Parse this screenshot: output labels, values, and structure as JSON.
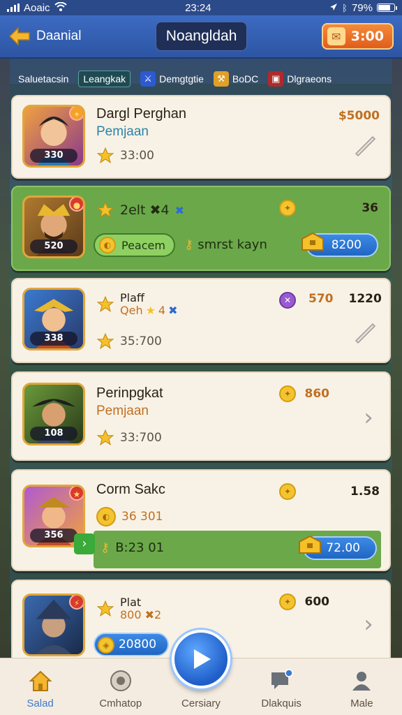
{
  "status_bar": {
    "carrier": "Aoaic",
    "time": "23:24",
    "battery": "79%"
  },
  "header": {
    "back_label": "Daanial",
    "title": "Noangldah",
    "coins": "3:00"
  },
  "filters": [
    {
      "label": "Saluetacsin",
      "active": false,
      "icon": ""
    },
    {
      "label": "Leangkak",
      "active": true,
      "icon": ""
    },
    {
      "label": "Demgtgtie",
      "active": false,
      "icon": "sword-icon"
    },
    {
      "label": "BoDC",
      "active": false,
      "icon": "trophy-icon"
    },
    {
      "label": "Dlgraeons",
      "active": false,
      "icon": "chest-icon"
    }
  ],
  "cards": [
    {
      "name": "Dargl Perghan",
      "role": "Pemjaan",
      "rating": "33:00",
      "avatar_level": "330",
      "price": "$5000"
    },
    {
      "name": "2elt ✖4",
      "action": "Peacem",
      "sub": "smrst kayn",
      "avatar_level": "520",
      "top_value": "36",
      "price": "8200"
    },
    {
      "name": "Plaff",
      "sub": "Qeh",
      "sub2": "4",
      "rating": "35:700",
      "avatar_level": "338",
      "price_old": "570",
      "price": "1220"
    },
    {
      "name": "Perinpgkat",
      "role": "Pemjaan",
      "rating": "33:700",
      "avatar_level": "108",
      "price": "860"
    },
    {
      "name": "Corm Sakc",
      "rating": "36 301",
      "avatar_level": "356",
      "top_value": "1.58",
      "sub": "B:23 01",
      "price": "72.00"
    },
    {
      "name": "Plat",
      "sub": "800 ✖2",
      "avatar_level": "",
      "top_value": "600",
      "price": "20800"
    }
  ],
  "bottom_nav": [
    {
      "label": "Salad",
      "icon": "home-icon",
      "active": true
    },
    {
      "label": "Cmhatop",
      "icon": "target-icon",
      "active": false
    },
    {
      "label": "Cersiary",
      "icon": "play-icon",
      "active": false
    },
    {
      "label": "Dlakquis",
      "icon": "chat-icon",
      "active": false
    },
    {
      "label": "Male",
      "icon": "profile-icon",
      "active": false
    }
  ],
  "colors": {
    "accent": "#3a7ad0",
    "header": "#2d55a3",
    "card": "#f8f2e6",
    "green_card": "#6ba84a",
    "price": "#c07022"
  }
}
